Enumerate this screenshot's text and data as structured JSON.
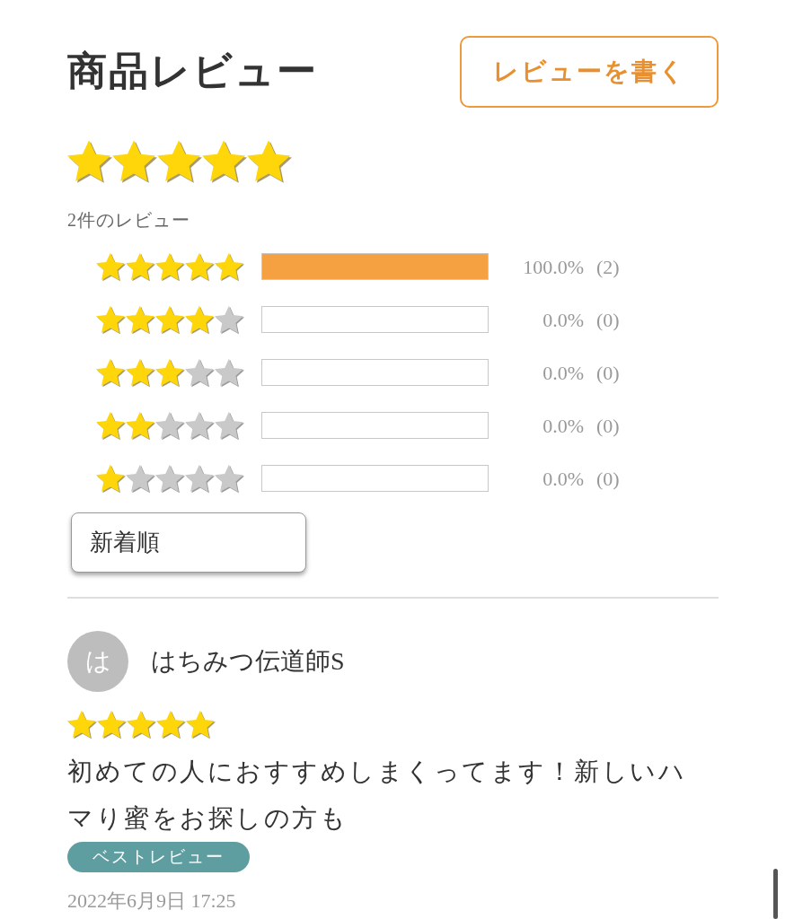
{
  "header": {
    "title": "商品レビュー",
    "write_button": "レビューを書く"
  },
  "summary": {
    "stars": 5,
    "count_label": "2件のレビュー"
  },
  "distribution": [
    {
      "stars": 5,
      "level": 1,
      "percent": "100.0%",
      "count": "(2)"
    },
    {
      "stars": 4,
      "level": 0,
      "percent": "0.0%",
      "count": "(0)"
    },
    {
      "stars": 3,
      "level": 0,
      "percent": "0.0%",
      "count": "(0)"
    },
    {
      "stars": 2,
      "level": 0,
      "percent": "0.0%",
      "count": "(0)"
    },
    {
      "stars": 1,
      "level": 0,
      "percent": "0.0%",
      "count": "(0)"
    }
  ],
  "sort": {
    "value": "新着順"
  },
  "reviews": [
    {
      "avatar": "は",
      "name": "はちみつ伝道師S",
      "stars": 5,
      "text": "初めての人におすすめしまくってます！新しいハマり蜜をお探しの方も",
      "badge": "ベストレビュー",
      "date": "2022年6月9日 17:25"
    }
  ]
}
